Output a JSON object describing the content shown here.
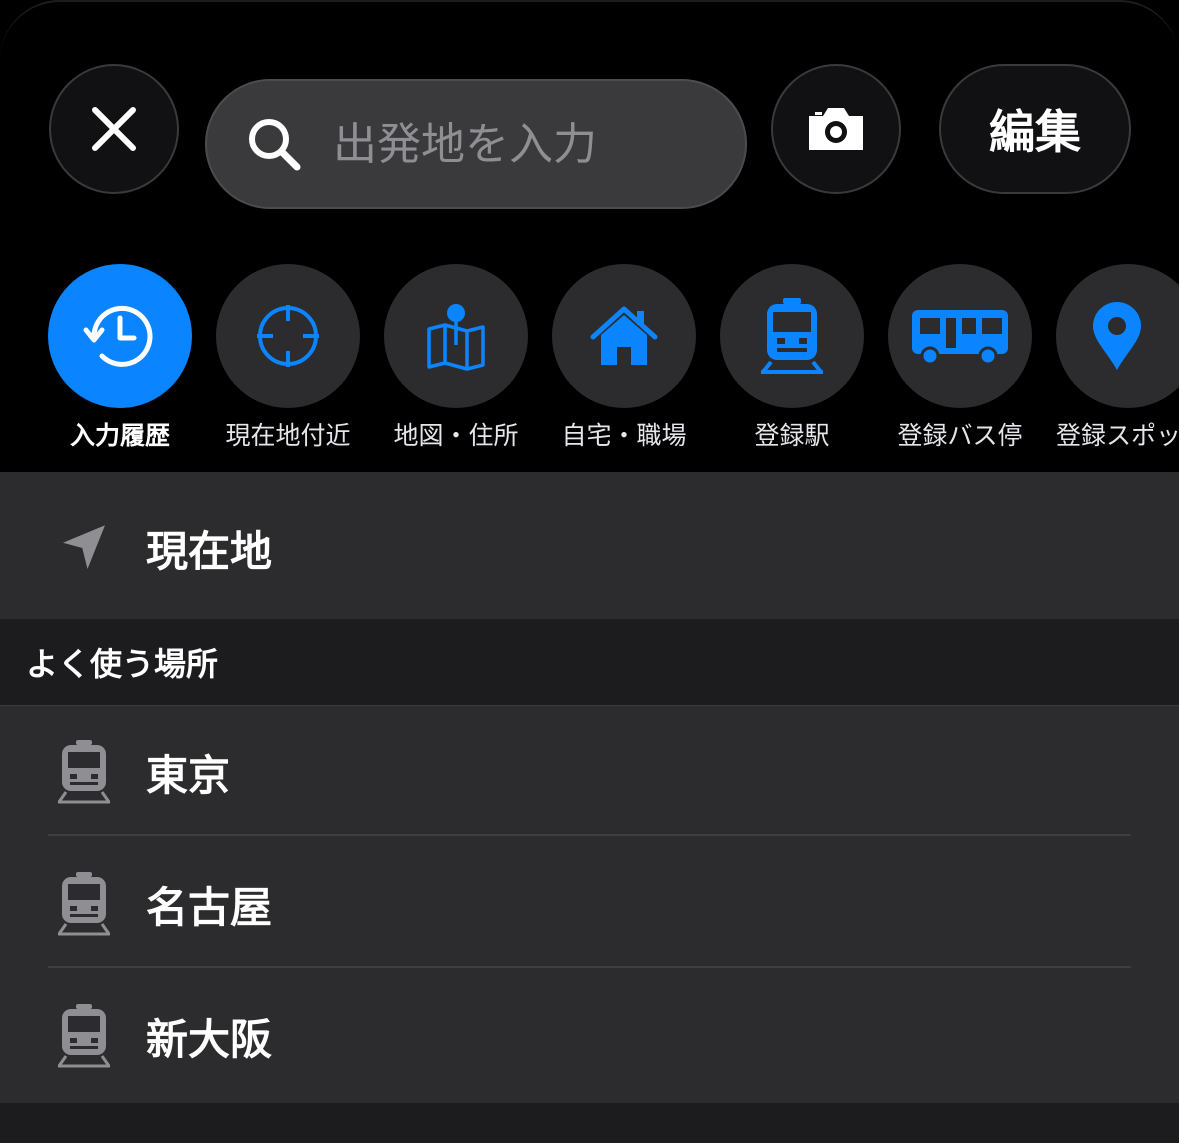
{
  "header": {
    "close_icon": "close-icon",
    "search_placeholder": "出発地を入力",
    "camera_icon": "camera-icon",
    "edit_label": "編集"
  },
  "categories": [
    {
      "label": "入力履歴",
      "icon": "history-clock-icon",
      "active": true
    },
    {
      "label": "現在地付近",
      "icon": "crosshair-icon",
      "active": false
    },
    {
      "label": "地図・住所",
      "icon": "map-pin-icon",
      "active": false
    },
    {
      "label": "自宅・職場",
      "icon": "home-icon",
      "active": false
    },
    {
      "label": "登録駅",
      "icon": "train-icon",
      "active": false
    },
    {
      "label": "登録バス停",
      "icon": "bus-icon",
      "active": false
    },
    {
      "label": "登録スポッ",
      "icon": "location-pin-icon",
      "active": false
    }
  ],
  "current_location": {
    "label": "現在地",
    "icon": "location-arrow-icon"
  },
  "favorites": {
    "header": "よく使う場所",
    "items": [
      {
        "label": "東京",
        "icon": "train-icon"
      },
      {
        "label": "名古屋",
        "icon": "train-icon"
      },
      {
        "label": "新大阪",
        "icon": "train-icon"
      }
    ]
  },
  "colors": {
    "accent": "#0a84ff",
    "background": "#000000",
    "list_background": "#2c2c2e",
    "section_background": "#1c1c1e"
  }
}
